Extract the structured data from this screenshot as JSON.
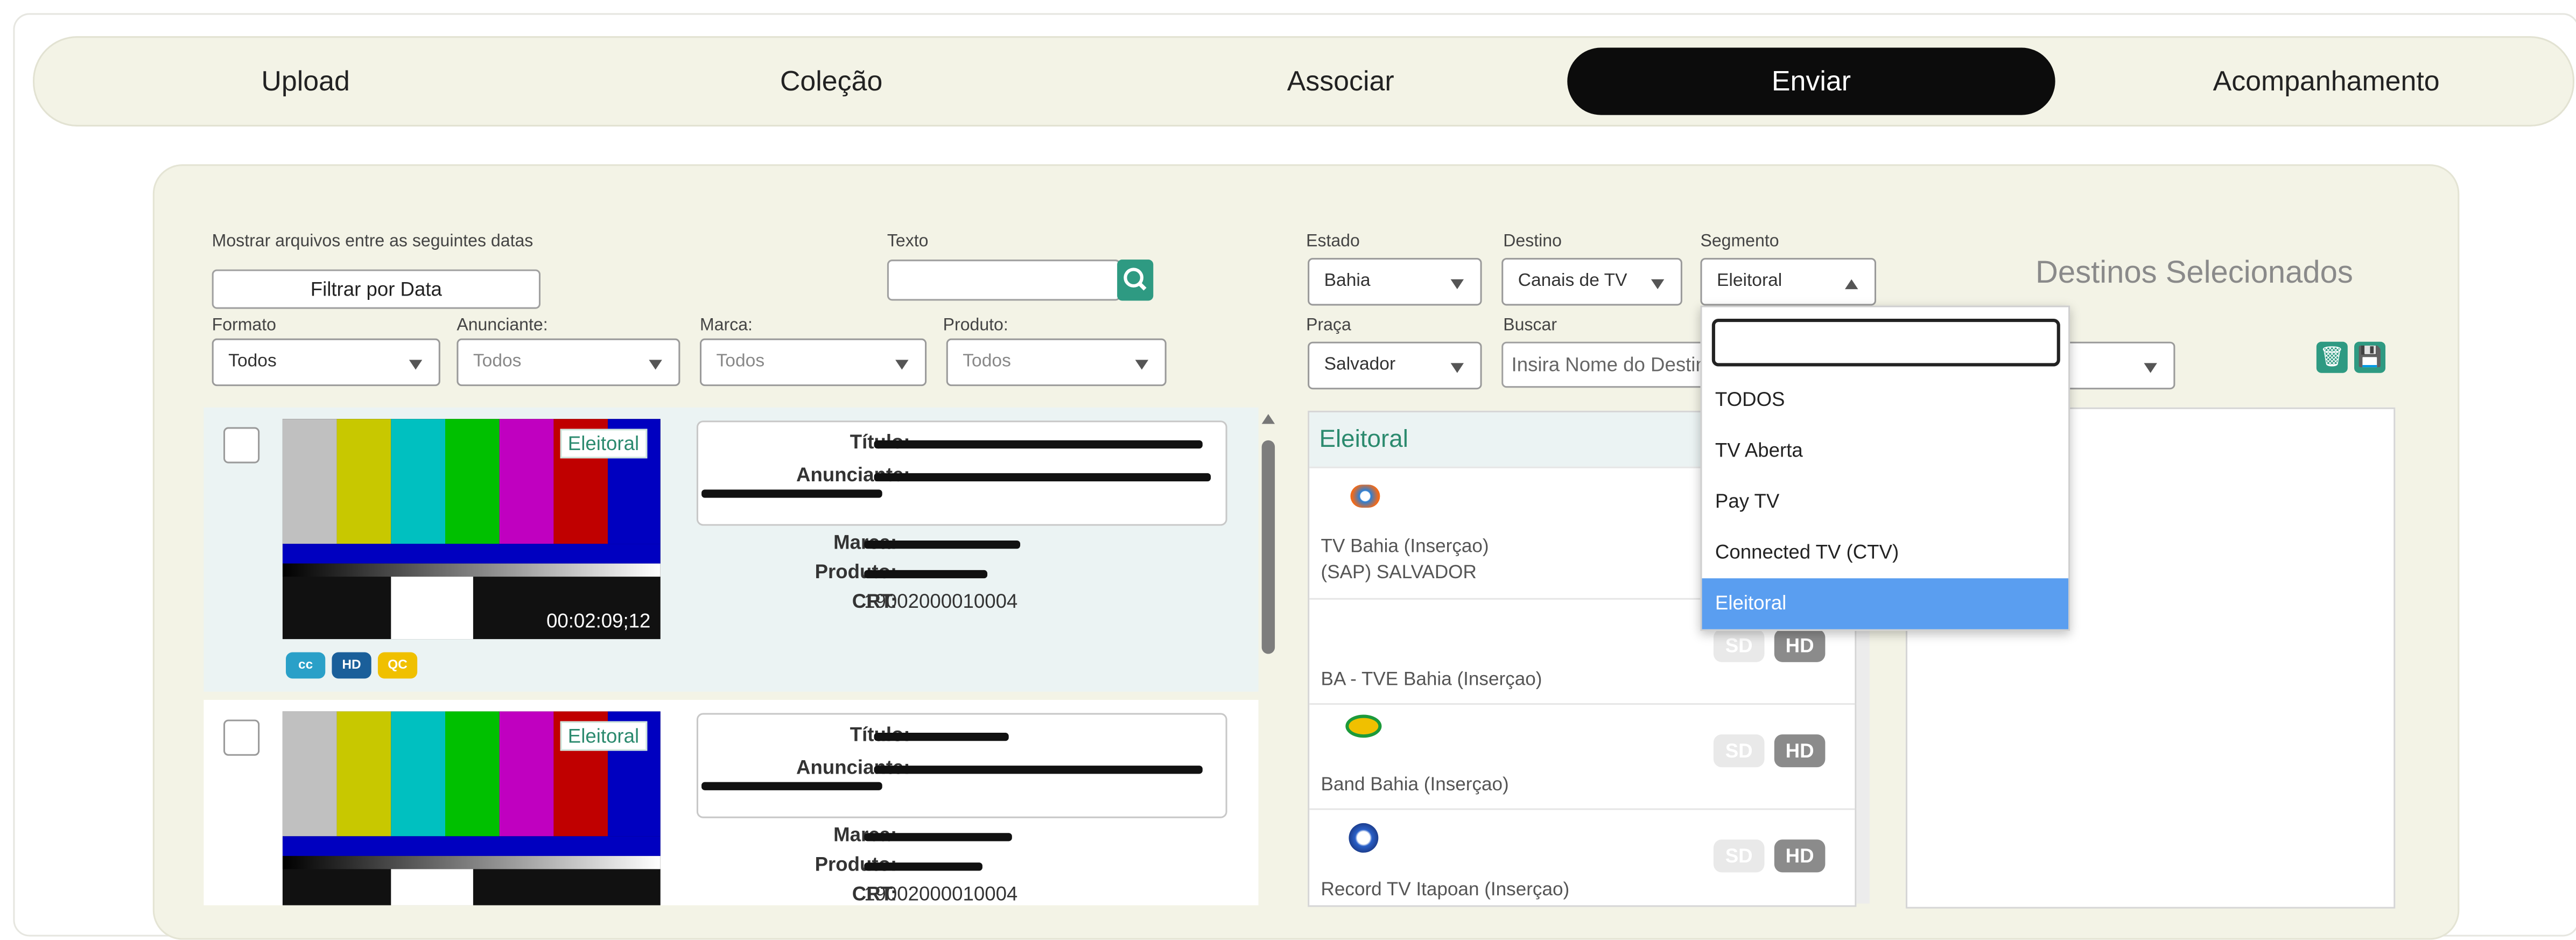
{
  "tabs": [
    "Upload",
    "Coleção",
    "Associar",
    "Enviar",
    "Acompanhamento"
  ],
  "active_tab": "Enviar",
  "filters": {
    "date_label": "Mostrar arquivos entre as seguintes datas",
    "date_button": "Filtrar por Data",
    "text_label": "Texto",
    "text_value": "",
    "formato_label": "Formato",
    "formato_value": "Todos",
    "anunciante_label": "Anunciante:",
    "anunciante_value": "Todos",
    "marca_label": "Marca:",
    "marca_value": "Todos",
    "produto_label": "Produto:",
    "produto_value": "Todos",
    "estado_label": "Estado",
    "estado_value": "Bahia",
    "destino_label": "Destino",
    "destino_value": "Canais de TV",
    "segmento_label": "Segmento",
    "segmento_value": "Eleitoral",
    "praca_label": "Praça",
    "praca_value": "Salvador",
    "buscar_label": "Buscar",
    "buscar_placeholder": "Insira Nome do Destino"
  },
  "segmento_options": [
    "TODOS",
    "TV Aberta",
    "Pay TV",
    "Connected TV (CTV)",
    "Eleitoral"
  ],
  "segmento_search": "",
  "destinos_title": "Destinos Selecionados",
  "files": [
    {
      "tag": "Eleitoral",
      "duration": "00:02:09;12",
      "titulo_label": "Título:",
      "anunciante_label": "Anunciante:",
      "marca_label": "Marca:",
      "produto_label": "Produto:",
      "crt_label": "CRT:",
      "crt": "19002000010004",
      "badges": [
        "cc",
        "HD",
        "QC"
      ]
    },
    {
      "tag": "Eleitoral",
      "duration": "",
      "titulo_label": "Título:",
      "anunciante_label": "Anunciante:",
      "marca_label": "Marca:",
      "produto_label": "Produto:",
      "crt_label": "CRT:",
      "crt": "19002000010004"
    }
  ],
  "channels_header": "Eleitoral",
  "channels": [
    {
      "name": "TV Bahia (Inserçao)",
      "sub": "(SAP) SALVADOR",
      "logo": "globo-logo"
    },
    {
      "name": "BA - TVE Bahia (Inserçao)",
      "logo": ""
    },
    {
      "name": "Band Bahia (Inserçao)",
      "logo": "band-logo"
    },
    {
      "name": "Record TV Itapoan (Inserçao)",
      "logo": "record-logo"
    }
  ],
  "quality": {
    "sd": "SD",
    "hd": "HD"
  },
  "colors": {
    "accent": "#2e9a82",
    "tab_active": "#0c0c0c",
    "selected_option": "#5a9ef0"
  }
}
